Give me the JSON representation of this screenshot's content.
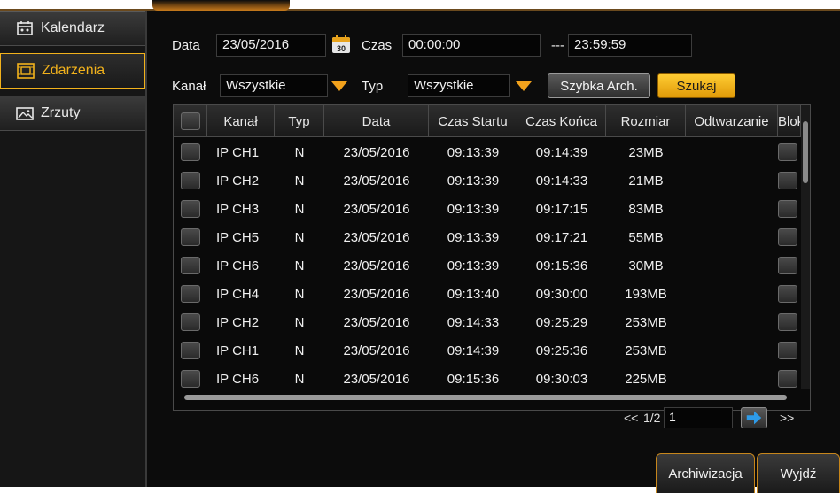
{
  "sidebar": {
    "items": [
      {
        "label": "Kalendarz",
        "icon": "calendar-icon",
        "active": false
      },
      {
        "label": "Zdarzenia",
        "icon": "events-icon",
        "active": true
      },
      {
        "label": "Zrzuty",
        "icon": "snapshot-icon",
        "active": false
      }
    ]
  },
  "filters": {
    "date_label": "Data",
    "date_value": "23/05/2016",
    "calendar_badge": "30",
    "time_label": "Czas",
    "time_from": "00:00:00",
    "time_separator": "---",
    "time_to": "23:59:59",
    "channel_label": "Kanał",
    "channel_value": "Wszystkie",
    "type_label": "Typ",
    "type_value": "Wszystkie",
    "quick_archive_label": "Szybka Arch.",
    "search_label": "Szukaj"
  },
  "table": {
    "columns": [
      "Kanał",
      "Typ",
      "Data",
      "Czas Startu",
      "Czas Końca",
      "Rozmiar",
      "Odtwarzanie",
      "Blokada"
    ],
    "rows": [
      {
        "channel": "IP CH1",
        "type": "N",
        "date": "23/05/2016",
        "start": "09:13:39",
        "end": "09:14:39",
        "size": "23MB"
      },
      {
        "channel": "IP CH2",
        "type": "N",
        "date": "23/05/2016",
        "start": "09:13:39",
        "end": "09:14:33",
        "size": "21MB"
      },
      {
        "channel": "IP CH3",
        "type": "N",
        "date": "23/05/2016",
        "start": "09:13:39",
        "end": "09:17:15",
        "size": "83MB"
      },
      {
        "channel": "IP CH5",
        "type": "N",
        "date": "23/05/2016",
        "start": "09:13:39",
        "end": "09:17:21",
        "size": "55MB"
      },
      {
        "channel": "IP CH6",
        "type": "N",
        "date": "23/05/2016",
        "start": "09:13:39",
        "end": "09:15:36",
        "size": "30MB"
      },
      {
        "channel": "IP CH4",
        "type": "N",
        "date": "23/05/2016",
        "start": "09:13:40",
        "end": "09:30:00",
        "size": "193MB"
      },
      {
        "channel": "IP CH2",
        "type": "N",
        "date": "23/05/2016",
        "start": "09:14:33",
        "end": "09:25:29",
        "size": "253MB"
      },
      {
        "channel": "IP CH1",
        "type": "N",
        "date": "23/05/2016",
        "start": "09:14:39",
        "end": "09:25:36",
        "size": "253MB"
      },
      {
        "channel": "IP CH6",
        "type": "N",
        "date": "23/05/2016",
        "start": "09:15:36",
        "end": "09:30:03",
        "size": "225MB"
      }
    ]
  },
  "pagination": {
    "prev": "<<",
    "page_info": "1/2",
    "page_input": "1",
    "next": ">>"
  },
  "footer": {
    "archive_label": "Archiwizacja",
    "exit_label": "Wyjdź"
  },
  "colors": {
    "accent": "#f2b21c",
    "background": "#0c0c0c",
    "button_gold": "#f5b41e"
  }
}
